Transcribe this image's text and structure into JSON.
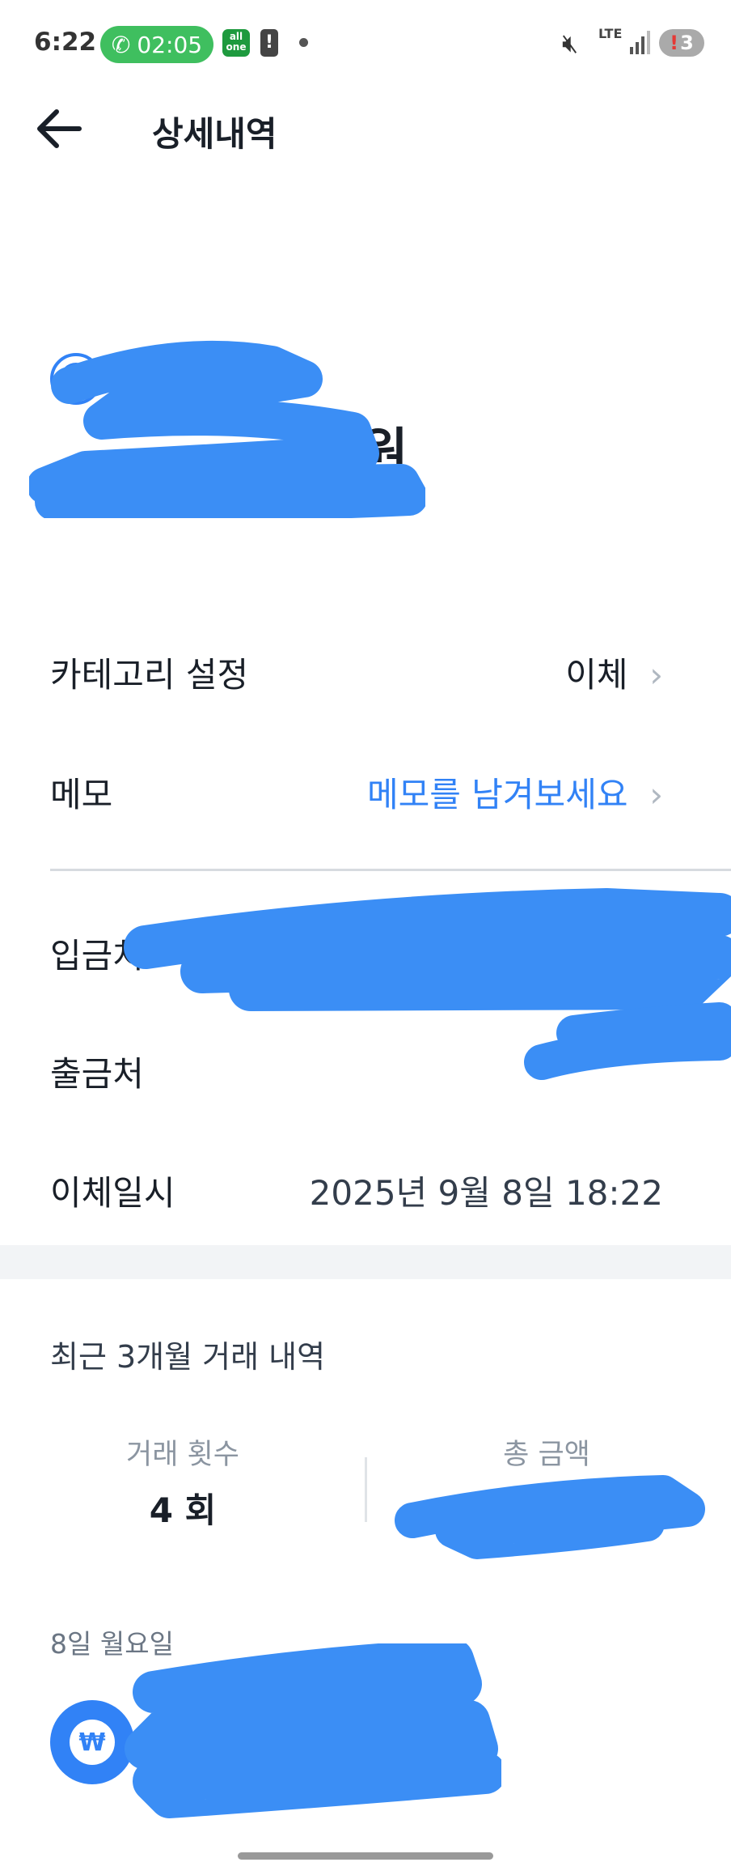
{
  "status_bar": {
    "time": "6:22",
    "call_timer": "02:05",
    "app_badge_top": "all",
    "app_badge_bottom": "one",
    "network": "LTE",
    "battery_badge": "3",
    "icons": [
      "phone-icon",
      "alert-icon",
      "mute-icon",
      "signal-icon",
      "battery-icon"
    ]
  },
  "header": {
    "title": "상세내역",
    "back_icon": "arrow-left-icon"
  },
  "hero": {
    "suffix": "원",
    "currency_symbol": "₩"
  },
  "rows": {
    "category": {
      "label": "카테고리 설정",
      "value": "이체"
    },
    "memo": {
      "label": "메모",
      "value": "메모를 남겨보세요"
    },
    "depositor": {
      "label": "입금처"
    },
    "withdrawer": {
      "label": "출금처"
    },
    "transfer_time": {
      "label": "이체일시",
      "value": "2025년 9월 8일 18:22"
    }
  },
  "recent": {
    "title": "최근 3개월 거래 내역",
    "count_label": "거래 횟수",
    "count_value": "4 회",
    "total_label": "총 금액"
  },
  "history": {
    "date_label": "8일 월요일",
    "item_symbol": "₩"
  },
  "colors": {
    "accent": "#3182f6",
    "redaction": "#3b8ef5",
    "text": "#191f28",
    "muted": "#8b95a1"
  }
}
